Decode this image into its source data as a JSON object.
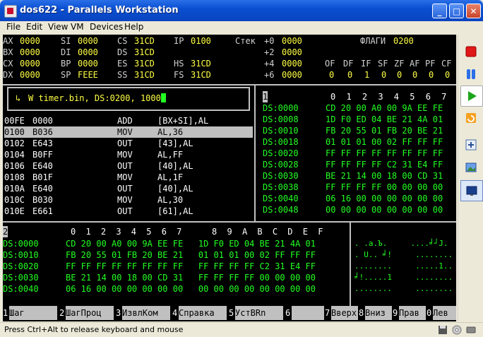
{
  "window": {
    "title": "dos622 - Parallels Workstation",
    "buttons": {
      "minimize": "_",
      "maximize": "□",
      "close": "✕"
    }
  },
  "menubar": [
    "File",
    "Edit",
    "View",
    "VM",
    "Devices",
    "Help"
  ],
  "registers": [
    {
      "row": [
        [
          "AX",
          "0000"
        ],
        [
          "SI",
          "0000"
        ],
        [
          "CS",
          "31CD"
        ],
        [
          "IP",
          "0100"
        ]
      ]
    },
    {
      "row": [
        [
          "BX",
          "0000"
        ],
        [
          "DI",
          "0000"
        ],
        [
          "DS",
          "31CD"
        ]
      ]
    },
    {
      "row": [
        [
          "CX",
          "0000"
        ],
        [
          "BP",
          "0000"
        ],
        [
          "ES",
          "31CD"
        ],
        [
          "HS",
          "31CD"
        ]
      ]
    },
    {
      "row": [
        [
          "DX",
          "0000"
        ],
        [
          "SP",
          "FEEE"
        ],
        [
          "SS",
          "31CD"
        ],
        [
          "FS",
          "31CD"
        ]
      ]
    }
  ],
  "stack": {
    "label": "Стек",
    "rows": [
      [
        "+0",
        "0000"
      ],
      [
        "+2",
        "0000"
      ],
      [
        "+4",
        "0000"
      ],
      [
        "+6",
        "0000"
      ]
    ]
  },
  "flags": {
    "label": "ФЛАГИ",
    "value": "0200",
    "names": [
      "OF",
      "DF",
      "IF",
      "SF",
      "ZF",
      "AF",
      "PF",
      "CF"
    ],
    "values": [
      "0",
      "0",
      "1",
      "0",
      "0",
      "0",
      "0",
      "0"
    ]
  },
  "command": {
    "arrow": "↳",
    "text": "W timer.bin, DS:0200, 1000"
  },
  "disasm": [
    {
      "addr": "00FE",
      "bytes": "0000",
      "op": "ADD",
      "args": "[BX+SI],AL"
    },
    {
      "addr": "0100",
      "bytes": "B036",
      "op": "MOV",
      "args": "AL,36"
    },
    {
      "addr": "0102",
      "bytes": "E643",
      "op": "OUT",
      "args": "[43],AL"
    },
    {
      "addr": "0104",
      "bytes": "B0FF",
      "op": "MOV",
      "args": "AL,FF"
    },
    {
      "addr": "0106",
      "bytes": "E640",
      "op": "OUT",
      "args": "[40],AL"
    },
    {
      "addr": "0108",
      "bytes": "B01F",
      "op": "MOV",
      "args": "AL,1F"
    },
    {
      "addr": "010A",
      "bytes": "E640",
      "op": "OUT",
      "args": "[40],AL"
    },
    {
      "addr": "010C",
      "bytes": "B030",
      "op": "MOV",
      "args": "AL,30"
    },
    {
      "addr": "010E",
      "bytes": "E661",
      "op": "OUT",
      "args": "[61],AL"
    }
  ],
  "dump_right": {
    "pane_no": "1",
    "header": "0 1 2 3 4 5 6 7",
    "rows": [
      {
        "addr": "DS:0000",
        "hex": "CD 20 00 A0 00 9A EE FE"
      },
      {
        "addr": "DS:0008",
        "hex": "1D F0 ED 04 BE 21 4A 01"
      },
      {
        "addr": "DS:0010",
        "hex": "FB 20 55 01 FB 20 BE 21"
      },
      {
        "addr": "DS:0018",
        "hex": "01 01 01 00 02 FF FF FF"
      },
      {
        "addr": "DS:0020",
        "hex": "FF FF FF FF FF FF FF FF"
      },
      {
        "addr": "DS:0028",
        "hex": "FF FF FF FF C2 31 E4 FF"
      },
      {
        "addr": "DS:0030",
        "hex": "BE 21 14 00 18 00 CD 31"
      },
      {
        "addr": "DS:0038",
        "hex": "FF FF FF FF 00 00 00 00"
      },
      {
        "addr": "DS:0040",
        "hex": "06 16 00 00 00 00 00 00"
      },
      {
        "addr": "DS:0048",
        "hex": "00 00 00 00 00 00 00 00"
      }
    ]
  },
  "dump_bottom": {
    "pane_no": "2",
    "header": "0 1 2 3 4 5 6 7   8 9 A B C D E F",
    "rows": [
      {
        "addr": "DS:0000",
        "hex": "CD 20 00 A0 00 9A EE FE   1D F0 ED 04 BE 21 4A 01",
        "ascii": ". .a.Ъ.     ....╛┘J."
      },
      {
        "addr": "DS:0010",
        "hex": "FB 20 55 01 FB 20 BE 21   01 01 01 00 02 FF FF FF",
        "ascii": ". U.. ╛!     ........"
      },
      {
        "addr": "DS:0020",
        "hex": "FF FF FF FF FF FF FF FF   FF FF FF FF C2 31 E4 FF",
        "ascii": "........     .....1.."
      },
      {
        "addr": "DS:0030",
        "hex": "BE 21 14 00 18 00 CD 31   FF FF FF FF 00 00 00 00",
        "ascii": "╛!.....1     ........"
      },
      {
        "addr": "DS:0040",
        "hex": "06 16 00 00 00 00 00 00   00 00 00 00 00 00 00 00",
        "ascii": "........     ........"
      }
    ]
  },
  "fkeys": [
    {
      "n": "1",
      "label": "Шаг"
    },
    {
      "n": "2",
      "label": "ШагПроц"
    },
    {
      "n": "3",
      "label": "ИзвлКом"
    },
    {
      "n": "4",
      "label": "Справка"
    },
    {
      "n": "5",
      "label": "УстBRn"
    },
    {
      "n": "6",
      "label": ""
    },
    {
      "n": "7",
      "label": "Вверх"
    },
    {
      "n": "8",
      "label": "Вниз"
    },
    {
      "n": "9",
      "label": "Прав"
    },
    {
      "n": "0",
      "label": "Лев"
    }
  ],
  "sidebar_icons": [
    "stop-icon",
    "pause-icon",
    "play-icon",
    "reset-icon",
    "fullscreen-icon",
    "screenshot-icon",
    "display-icon"
  ],
  "status": {
    "text": "Press Ctrl+Alt to release keyboard and mouse"
  }
}
